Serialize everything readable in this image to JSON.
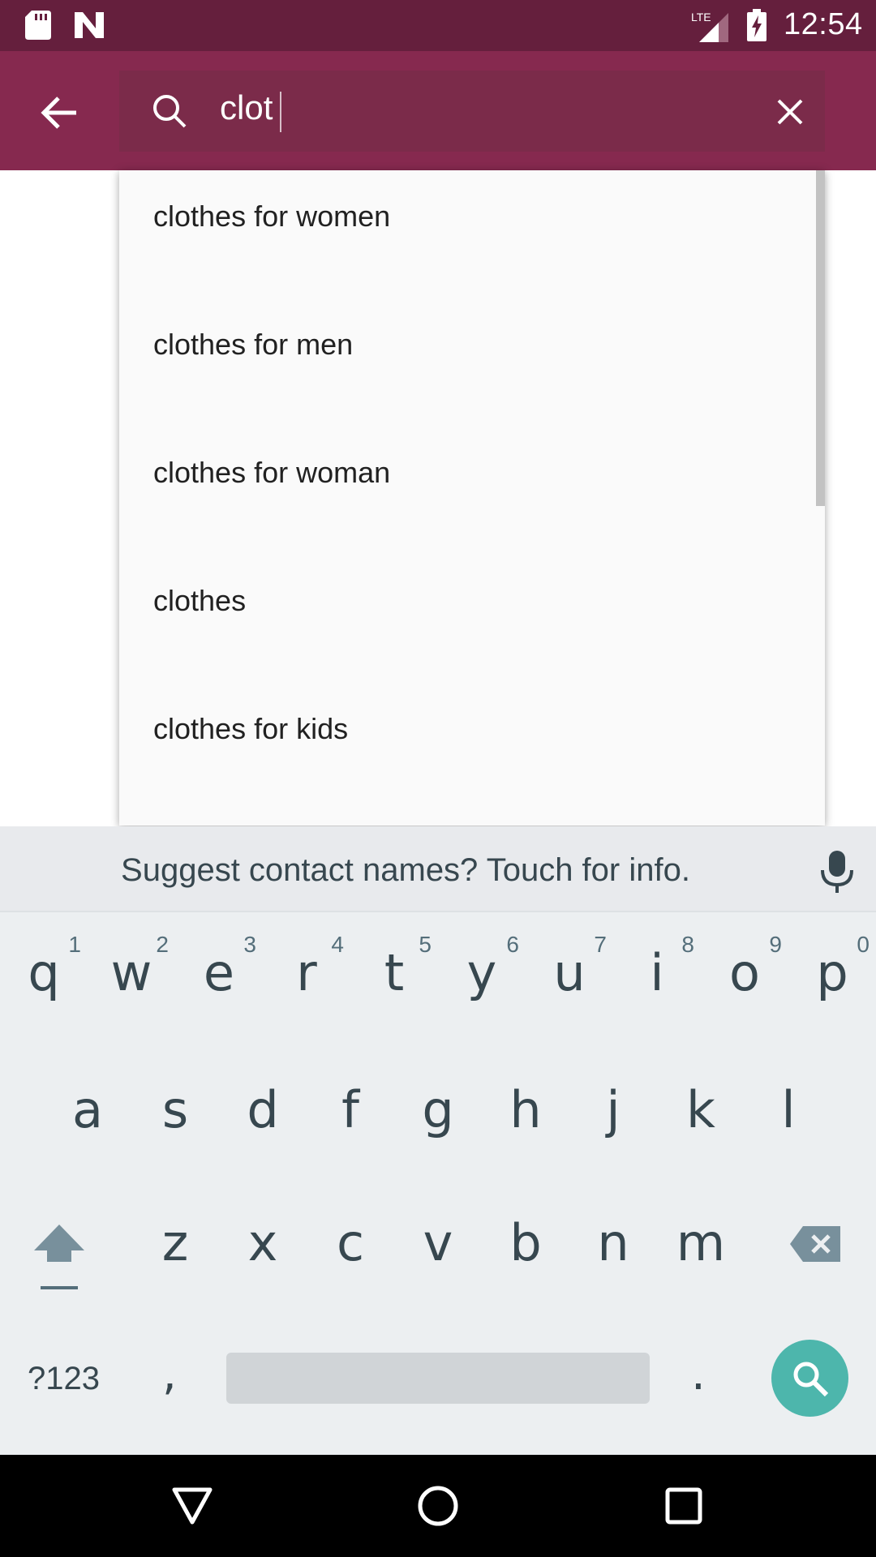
{
  "status_bar": {
    "time": "12:54",
    "network": "LTE",
    "icons": [
      "sd-card-icon",
      "n-icon",
      "signal-icon",
      "battery-charging-icon"
    ]
  },
  "app_bar": {
    "back_icon": "arrow-back-icon",
    "search": {
      "icon": "search-icon",
      "query": "clot",
      "clear_icon": "close-icon"
    },
    "colors": {
      "status": "#651f3d",
      "bar": "#86294f",
      "search_box": "#7b2b4a"
    }
  },
  "suggestions": [
    "clothes for women",
    "clothes for men",
    "clothes for woman",
    "clothes",
    "clothes for kids"
  ],
  "keyboard": {
    "hint": "Suggest contact names? Touch for info.",
    "mic_icon": "mic-icon",
    "row1": [
      {
        "key": "q",
        "num": "1"
      },
      {
        "key": "w",
        "num": "2"
      },
      {
        "key": "e",
        "num": "3"
      },
      {
        "key": "r",
        "num": "4"
      },
      {
        "key": "t",
        "num": "5"
      },
      {
        "key": "y",
        "num": "6"
      },
      {
        "key": "u",
        "num": "7"
      },
      {
        "key": "i",
        "num": "8"
      },
      {
        "key": "o",
        "num": "9"
      },
      {
        "key": "p",
        "num": "0"
      }
    ],
    "row2": [
      "a",
      "s",
      "d",
      "f",
      "g",
      "h",
      "j",
      "k",
      "l"
    ],
    "row3": [
      "z",
      "x",
      "c",
      "v",
      "b",
      "n",
      "m"
    ],
    "symbols_label": "?123",
    "comma": ",",
    "period": ".",
    "action_color": "#4db6ac"
  },
  "nav_bar": {
    "back": "triangle-back-icon",
    "home": "circle-home-icon",
    "recents": "square-recents-icon"
  }
}
